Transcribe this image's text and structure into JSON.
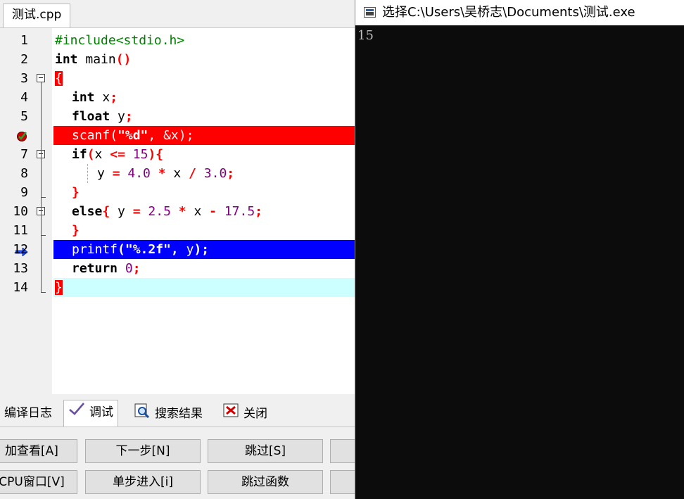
{
  "editor": {
    "file_tab": "测试.cpp",
    "lines": [
      {
        "num": "1",
        "code": "#include<stdio.h>"
      },
      {
        "num": "2",
        "code": "int main()"
      },
      {
        "num": "3",
        "code": "{"
      },
      {
        "num": "4",
        "code": "int x;"
      },
      {
        "num": "5",
        "code": "float y;"
      },
      {
        "num": "6",
        "code": "scanf(\"%d\", &x);"
      },
      {
        "num": "7",
        "code": "if(x <= 15){"
      },
      {
        "num": "8",
        "code": "y = 4.0 * x / 3.0;"
      },
      {
        "num": "9",
        "code": "}"
      },
      {
        "num": "10",
        "code": "else{ y = 2.5 * x - 17.5;"
      },
      {
        "num": "11",
        "code": "}"
      },
      {
        "num": "12",
        "code": "printf(\"%.2f\", y);"
      },
      {
        "num": "13",
        "code": "return 0;"
      },
      {
        "num": "14",
        "code": "}"
      }
    ],
    "breakpoint_line": "6",
    "current_line": "12",
    "colors": {
      "breakpoint_bg": "#ff0000",
      "current_bg": "#0000ff",
      "brace_match_bg": "#ccffff"
    }
  },
  "bottom_panel": {
    "tabs": [
      {
        "label": "编译日志",
        "icon": ""
      },
      {
        "label": "调试",
        "icon": "check-icon"
      },
      {
        "label": "搜索结果",
        "icon": "search-results-icon"
      },
      {
        "label": "关闭",
        "icon": "close-panel-icon"
      }
    ],
    "buttons_row1": [
      "加查看[A]",
      "下一步[N]",
      "跳过[S]"
    ],
    "buttons_row2": [
      "CPU窗口[V]",
      "单步进入[i]",
      "跳过函数"
    ]
  },
  "console": {
    "title": "选择C:\\Users\\吴桥志\\Documents\\测试.exe",
    "output": "15"
  }
}
